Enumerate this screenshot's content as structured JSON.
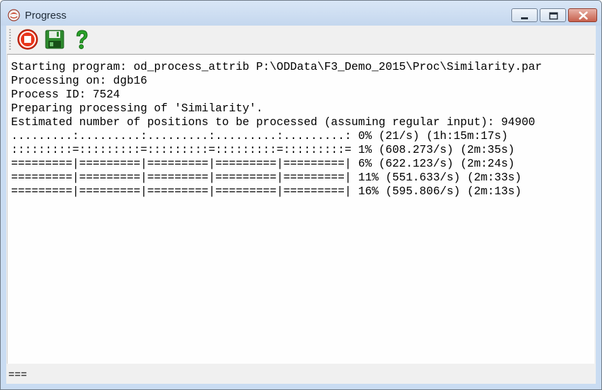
{
  "window": {
    "title": "Progress",
    "icon": "app-logo-icon"
  },
  "title_buttons": {
    "minimize": "minimize-icon",
    "maximize": "maximize-icon",
    "close": "close-icon"
  },
  "toolbar": {
    "stop": "stop-icon",
    "save": "save-icon",
    "help": "help-icon"
  },
  "log": {
    "lines": [
      "Starting program: od_process_attrib P:\\ODData\\F3_Demo_2015\\Proc\\Similarity.par",
      "Processing on: dgb16",
      "Process ID: 7524",
      "Preparing processing of 'Similarity'.",
      "Estimated number of positions to be processed (assuming regular input): 94900",
      ".........:.........:.........:.........:.........: 0% (21/s) (1h:15m:17s)",
      ":::::::::=:::::::::=:::::::::=:::::::::=:::::::::= 1% (608.273/s) (2m:35s)",
      "=========|=========|=========|=========|=========| 6% (622.123/s) (2m:24s)",
      "=========|=========|=========|=========|=========| 11% (551.633/s) (2m:33s)",
      "=========|=========|=========|=========|=========| 16% (595.806/s) (2m:13s)"
    ]
  },
  "status": {
    "text": "==="
  },
  "colors": {
    "stop": "#e8361c",
    "save": "#2e8b2e",
    "help": "#2aa22a"
  }
}
